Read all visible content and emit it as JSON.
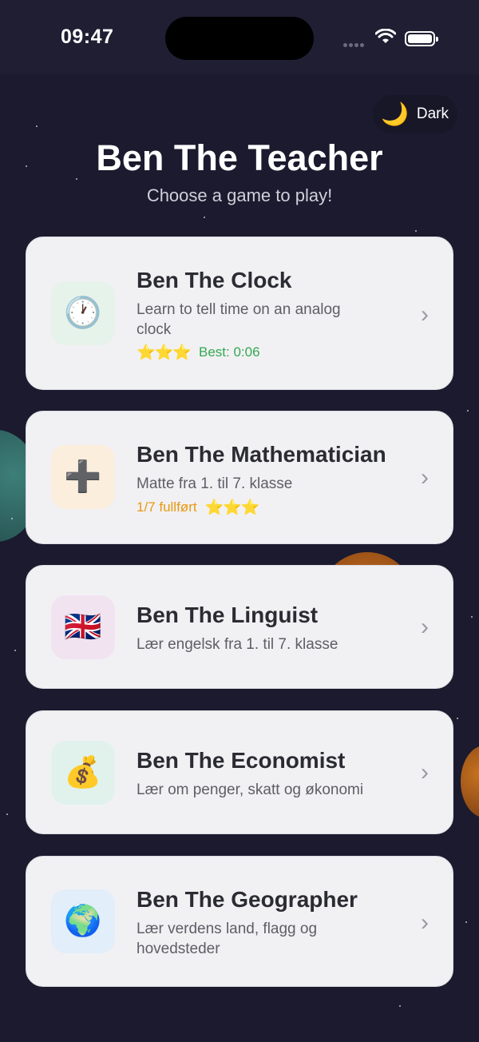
{
  "status_bar": {
    "time": "09:47"
  },
  "theme_toggle": {
    "icon": "🌙",
    "label": "Dark"
  },
  "header": {
    "title": "Ben The Teacher",
    "subtitle": "Choose a game to play!"
  },
  "games": [
    {
      "icon": "🕐",
      "icon_name": "clock-icon",
      "icon_bg": "#e6f3ea",
      "name": "Ben The Clock",
      "description": "Learn to tell time on an analog clock",
      "stars": "⭐⭐⭐",
      "best": "Best: 0:06",
      "best_color": "#34a853"
    },
    {
      "icon": "➕",
      "icon_name": "plus-icon",
      "icon_bg": "#fbeedd",
      "name": "Ben The Mathematician",
      "description": "Matte fra 1. til 7. klasse",
      "progress": "1/7 fullført",
      "progress_color": "#e8980f",
      "stars": "⭐⭐⭐"
    },
    {
      "icon": "🇬🇧",
      "icon_name": "uk-flag-icon",
      "icon_bg": "#f2e3f1",
      "name": "Ben The Linguist",
      "description": "Lær engelsk fra 1. til 7. klasse"
    },
    {
      "icon": "💰",
      "icon_name": "money-bag-icon",
      "icon_bg": "#e1f2ec",
      "name": "Ben The Economist",
      "description": "Lær om penger, skatt og økonomi"
    },
    {
      "icon": "🌍",
      "icon_name": "globe-icon",
      "icon_bg": "#e2eef9",
      "name": "Ben The Geographer",
      "description": "Lær verdens land, flagg og hovedsteder"
    }
  ],
  "chevron": "›"
}
